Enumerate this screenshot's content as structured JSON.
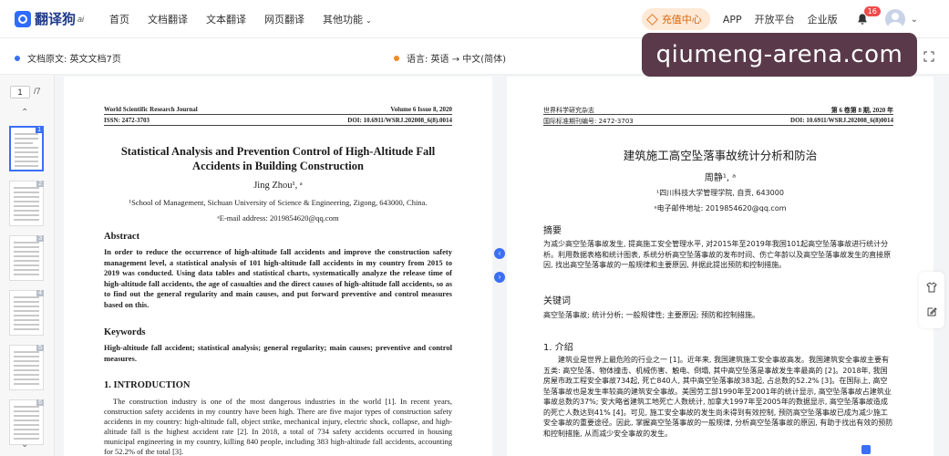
{
  "nav": {
    "logo_text": "翻译狗",
    "logo_sub": "ai",
    "links": [
      "首页",
      "文档翻译",
      "文本翻译",
      "网页翻译",
      "其他功能"
    ],
    "charge_label": "充值中心",
    "right_links": [
      "APP",
      "开放平台",
      "企业版"
    ],
    "notif_count": "16"
  },
  "subbar": {
    "source_label": "文档原文: 英文文档7页",
    "lang_label": "语言:  英语 → 中文(简体)",
    "watermark": "qiumeng-arena.com"
  },
  "thumbs": {
    "current_page": "1",
    "total": "/7",
    "pages": [
      "1",
      "2",
      "3",
      "4",
      "5",
      "6"
    ]
  },
  "en": {
    "journal": "World Scientific Research Journal",
    "volume": "Volume 6 Issue 8, 2020",
    "issn": "ISSN: 2472-3703",
    "doi": "DOI: 10.6911/WSRJ.202008_6(8).0014",
    "title": "Statistical Analysis and Prevention Control of High-Altitude Fall Accidents in Building Construction",
    "author": "Jing Zhou¹, ᵃ",
    "affiliation": "¹School of Management, Sichuan University of Science & Engineering, Zigong, 643000, China.",
    "email": "ᵃE-mail address: 2019854620@qq.com",
    "abstract_h": "Abstract",
    "abstract": "In order to reduce the occurrence of high-altitude fall accidents and improve the construction safety management level, a statistical analysis of 101 high-altitude fall accidents in my country from 2015 to 2019 was conducted. Using data tables and statistical charts, systematically analyze the release time of high-altitude fall accidents, the age of casualties and the direct causes of high-altitude fall accidents, so as to find out the general regularity and main causes, and put forward preventive and control measures based on this.",
    "keywords_h": "Keywords",
    "keywords": "High-altitude fall accident; statistical analysis; general regularity; main causes; preventive and control measures.",
    "intro_h": "1.   INTRODUCTION",
    "intro": "The construction industry is one of the most dangerous industries in the world [1]. In recent years, construction safety accidents in my country have been high. There are five major types of construction safety accidents in my country: high-altitude fall, object strike, mechanical injury, electric shock, collapse, and high-altitude fall is the highest accident rate [2]. In 2018, a total of 734 safety accidents occurred in housing municipal engineering in my country, killing 840 people, including 383 high-altitude fall accidents, accounting for 52.2% of the total [3]."
  },
  "zh": {
    "journal": "世界科学研究杂志",
    "volume": "第 6 卷第 8 期, 2020 年",
    "issn": "国际标准期刊编号: 2472-3703",
    "doi": "DOI: 10.6911/WSRJ.202008_6(8)0014",
    "title": "建筑施工高空坠落事故统计分析和防治",
    "author": "周静¹, ᵃ",
    "affiliation": "¹四川科技大学管理学院, 自贡, 643000",
    "email": "ᵃ电子邮件地址: 2019854620@qq.com",
    "abstract_h": "摘要",
    "abstract": "为减少高空坠落事故发生, 提高施工安全管理水平, 对2015年至2019年我国101起高空坠落事故进行统计分析。利用数据表格和统计图表, 系统分析高空坠落事故的发布时间、伤亡年龄以及高空坠落事故发生的直接原因, 找出高空坠落事故的一般规律和主要原因, 并据此提出预防和控制措施。",
    "keywords_h": "关键词",
    "keywords": "高空坠落事故; 统计分析; 一般规律性; 主要原因; 预防和控制措施。",
    "intro_h": "1.  介绍",
    "intro": "建筑业是世界上最危险的行业之一 [1]。近年来, 我国建筑施工安全事故高发。我国建筑安全事故主要有五类: 高空坠落、物体撞击、机械伤害、触电、倒塌, 其中高空坠落是事故发生率最高的 [2]。2018年, 我国房屋市政工程安全事故734起, 死亡840人, 其中高空坠落事故383起, 占总数的52.2% [3]。在国际上, 高空坠落事故也是发生率较高的建筑安全事故。美国劳工部1990年至2001年的统计显示, 高空坠落事故占建筑业事故总数的37%; 安大略省建筑工地死亡人数统计, 加拿大1997年至2005年的数据显示, 高空坠落事故造成的死亡人数达到41% [4]。可见, 施工安全事故的发生尚未得到有效控制, 预防高空坠落事故已成为减少施工安全事故的重要途径。因此, 掌握高空坠落事故的一般规律, 分析高空坠落事故的原因, 有助于找出有效的预防和控制措施, 从而减少安全事故的发生。"
  },
  "colors": {
    "accent": "#3b6ff5",
    "charge_bg": "#fde9d6",
    "charge_fg": "#d9650b",
    "badge": "#f04b4b"
  }
}
